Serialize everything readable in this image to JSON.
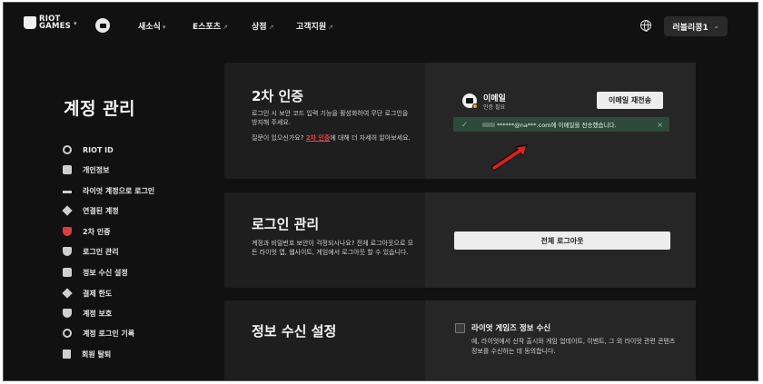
{
  "nav": {
    "logo_line1": "RIOT",
    "logo_line2": "GAMES",
    "links": [
      {
        "label": "새소식",
        "suffix": "▾"
      },
      {
        "label": "E스포츠",
        "suffix": "↗"
      },
      {
        "label": "상점",
        "suffix": "↗"
      },
      {
        "label": "고객지원",
        "suffix": "↗"
      }
    ],
    "user_label": "러블리콩1"
  },
  "sidebar": {
    "title": "계정 관리",
    "items": [
      {
        "label": "RIOT ID",
        "icon": "face-icon"
      },
      {
        "label": "개인정보",
        "icon": "id-card-icon"
      },
      {
        "label": "라이엇 계정으로 로그인",
        "icon": "key-icon"
      },
      {
        "label": "연결된 계정",
        "icon": "layers-icon"
      },
      {
        "label": "2차 인증",
        "icon": "shield-icon"
      },
      {
        "label": "로그인 관리",
        "icon": "login-icon"
      },
      {
        "label": "정보 수신 설정",
        "icon": "chat-icon"
      },
      {
        "label": "결제 한도",
        "icon": "gem-icon"
      },
      {
        "label": "계정 보호",
        "icon": "protect-icon"
      },
      {
        "label": "계정 로그인 기록",
        "icon": "history-icon"
      },
      {
        "label": "회원 탈퇴",
        "icon": "exit-icon"
      }
    ]
  },
  "mfa": {
    "title": "2차 인증",
    "desc": "로그인 시 보안 코드 입력 기능을 활성화하여 무단 로그인을 방지해 주세요.",
    "help_prefix": "질문이 있으신가요? ",
    "help_link": "2차 인증",
    "help_suffix": "에 대해 더 자세히 알아보세요.",
    "method_title": "이메일",
    "method_status": "인증 필요",
    "resend_label": "이메일 재전송",
    "toast_text": "******@na***.com에 이메일을 전송했습니다.",
    "close_glyph": "×",
    "check_glyph": "✓"
  },
  "login_mgmt": {
    "title": "로그인 관리",
    "desc": "계정과 비밀번호 보안이 걱정되시나요? 전체 로그아웃으로 모든 라이엇 앱, 웹사이트, 게임에서 로그아웃 할 수 있습니다.",
    "button_label": "전체 로그아웃"
  },
  "comms": {
    "title": "정보 수신 설정",
    "checkbox_label": "라이엇 게임즈 정보 수신",
    "checkbox_checked": false,
    "checkbox_desc": "예, 라이엇에서 신작 출시와 게임 업데이트, 이벤트, 그 외 라이엇 관련 콘텐츠 정보를 수신하는 데 동의합니다."
  }
}
